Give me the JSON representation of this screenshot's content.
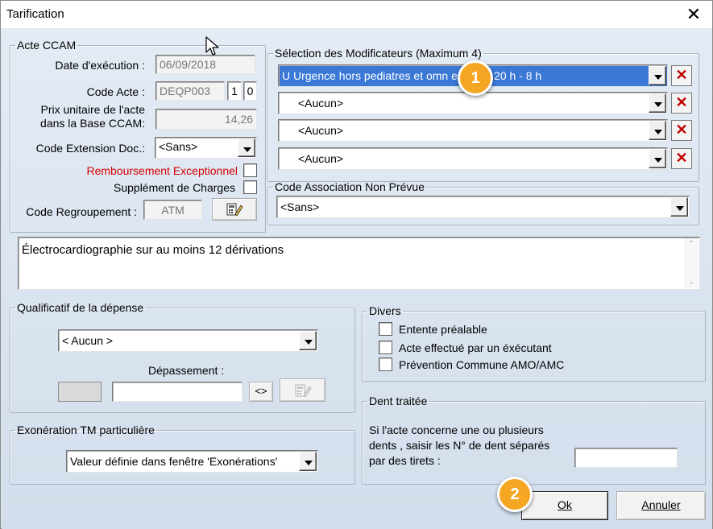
{
  "window": {
    "title": "Tarification",
    "close_glyph": "✕"
  },
  "acte_ccam": {
    "legend": "Acte CCAM",
    "date_label": "Date d'exécution :",
    "date_value": "06/09/2018",
    "code_label": "Code Acte :",
    "code_value": "DEQP003",
    "code_part2": "1",
    "code_part3": "0",
    "prix_label_1": "Prix unitaire de l'acte",
    "prix_label_2": "dans la Base CCAM:",
    "prix_value": "14,26",
    "ext_label": "Code Extension Doc.:",
    "ext_value": "<Sans>",
    "remboursement_label": "Remboursement Exceptionnel",
    "supplement_label": "Supplément de Charges",
    "regroupement_label": "Code Regroupement :",
    "regroupement_value": "ATM"
  },
  "modificateurs": {
    "legend": "Sélection des Modificateurs (Maximum 4)",
    "items": [
      {
        "value": "U  Urgence hors pediatres et omn           ens nuit 20 h - 8 h",
        "selected": true
      },
      {
        "value": "<Aucun>",
        "selected": false
      },
      {
        "value": "<Aucun>",
        "selected": false
      },
      {
        "value": "<Aucun>",
        "selected": false
      }
    ]
  },
  "association": {
    "legend": "Code Association Non Prévue",
    "value": "<Sans>"
  },
  "description": "Électrocardiographie sur au moins 12 dérivations",
  "qualificatif": {
    "legend": "Qualificatif de la dépense",
    "value": "< Aucun >",
    "depassement_label": "Dépassement :",
    "depassement_value": "",
    "toggle_label": "<>"
  },
  "divers": {
    "legend": "Divers",
    "options": [
      {
        "label": "Entente préalable",
        "checked": false
      },
      {
        "label": "Acte effectué par un éxécutant",
        "checked": false
      },
      {
        "label": "Prévention Commune AMO/AMC",
        "checked": false
      }
    ]
  },
  "exoneration": {
    "legend": "Exonération TM particulière",
    "value": "Valeur définie dans fenêtre 'Exonérations'"
  },
  "dent": {
    "legend": "Dent traitée",
    "text_1": "Si l'acte concerne une ou plusieurs",
    "text_2": "dents , saisir les N° de dent séparés",
    "text_3": "par des tirets :",
    "value": ""
  },
  "buttons": {
    "ok_label": "Ok",
    "annuler_label": "Annuler"
  },
  "badges": {
    "first": "1",
    "second": "2"
  },
  "colors": {
    "accent_badge": "#f5a623",
    "selection": "#3a78d6",
    "warning_text": "#d40000",
    "delete_icon": "#c00000"
  },
  "icons": {
    "close": "close-icon",
    "delete": "delete-x-icon",
    "calculator": "calculator-edit-icon",
    "cursor": "mouse-pointer-icon"
  }
}
